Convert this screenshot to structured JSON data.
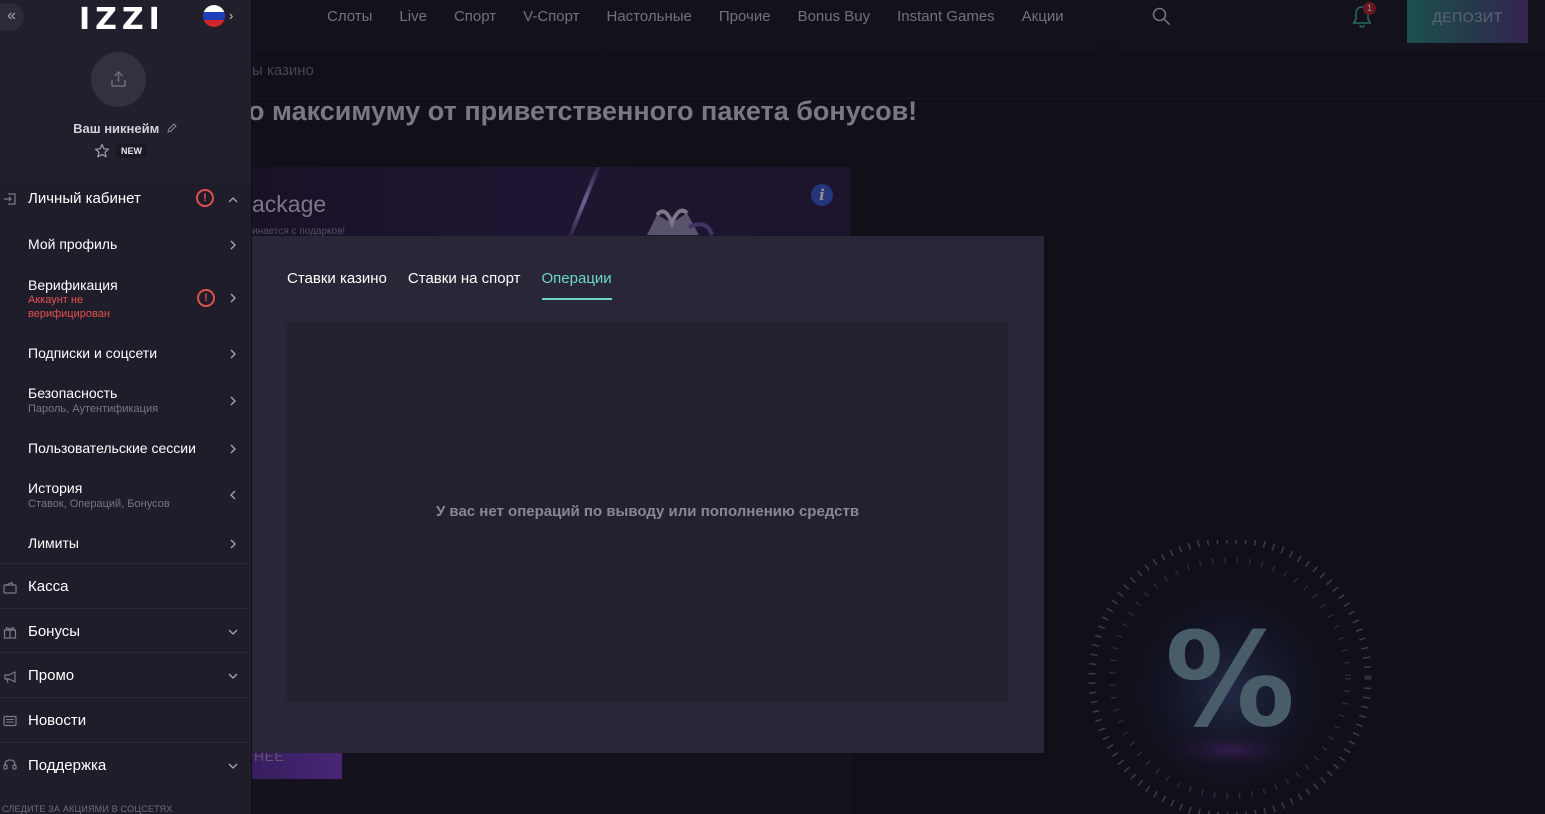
{
  "header": {
    "nav": [
      "Слоты",
      "Live",
      "Спорт",
      "V-Спорт",
      "Настольные",
      "Прочие",
      "Bonus Buy",
      "Instant Games",
      "Акции"
    ],
    "notification_count": "1",
    "deposit_label": "ДЕПОЗИТ"
  },
  "page": {
    "breadcrumb": "ы казино",
    "title": "о максимуму от приветственного пакета бонусов!",
    "promo_title": "ackage",
    "promo_subtitle": "инается с подарков!",
    "promo_button": "НЕЕ",
    "percent_symbol": "%"
  },
  "modal": {
    "tabs": [
      {
        "label": "Ставки казино",
        "active": false
      },
      {
        "label": "Ставки на спорт",
        "active": false
      },
      {
        "label": "Операции",
        "active": true
      }
    ],
    "empty_message": "У вас нет операций по выводу или пополнению средств"
  },
  "sidebar": {
    "logo": "IZZI",
    "nickname": "Ваш никнейм",
    "level_badge": "NEW",
    "menu": {
      "cabinet": "Личный кабинет",
      "profile": "Мой профиль",
      "verification": "Верификация",
      "verification_status": "Аккаунт не верифицирован",
      "subscriptions": "Подписки и соцсети",
      "security": "Безопасность",
      "security_sub": "Пароль, Аутентификация",
      "sessions": "Пользовательские сессии",
      "history": "История",
      "history_sub": "Ставок, Операций, Бонусов",
      "limits": "Лимиты",
      "cashier": "Касса",
      "bonuses": "Бонусы",
      "promo": "Промо",
      "news": "Новости",
      "support": "Поддержка"
    },
    "footer_note": "СЛЕДИТЕ ЗА АКЦИЯМИ В СОЦСЕТЯХ"
  },
  "colors": {
    "accent": "#6fd5cb",
    "warning": "#e05050",
    "background": "#16141f",
    "modal": "#292637",
    "sidebar": "#1f1d29"
  }
}
